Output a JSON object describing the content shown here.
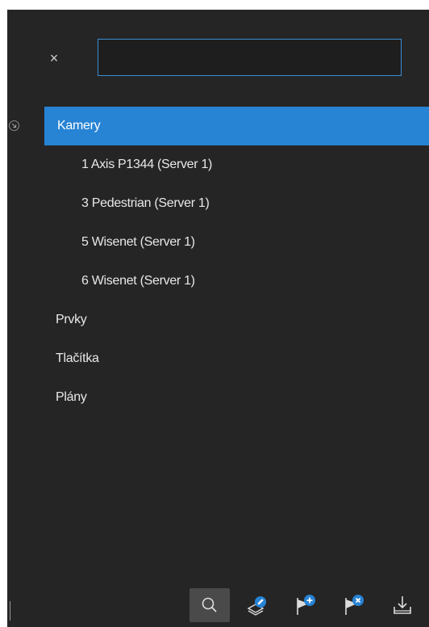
{
  "search": {
    "close_glyph": "×",
    "value": "",
    "placeholder": ""
  },
  "tree": {
    "collapse_icon": "collapse-circle-icon",
    "groups": [
      {
        "label": "Kamery",
        "selected": true,
        "expanded": true,
        "items": [
          {
            "label": "1 Axis P1344 (Server 1)"
          },
          {
            "label": "3 Pedestrian (Server 1)"
          },
          {
            "label": "5 Wisenet (Server 1)"
          },
          {
            "label": "6 Wisenet (Server 1)"
          }
        ]
      },
      {
        "label": "Prvky"
      },
      {
        "label": "Tlačítka"
      },
      {
        "label": "Plány"
      }
    ]
  },
  "toolbar": {
    "tools": [
      {
        "icon": "search-icon",
        "active": true
      },
      {
        "icon": "edit-layer-icon",
        "active": false
      },
      {
        "icon": "flag-add-icon",
        "active": false
      },
      {
        "icon": "flag-remove-icon",
        "active": false
      },
      {
        "icon": "download-icon",
        "active": false
      }
    ]
  },
  "colors": {
    "panel_bg": "#252525",
    "selection": "#2783d4",
    "input_border": "#3a8ed6",
    "icon_accent": "#2783d4",
    "text": "#e8e8e8"
  }
}
